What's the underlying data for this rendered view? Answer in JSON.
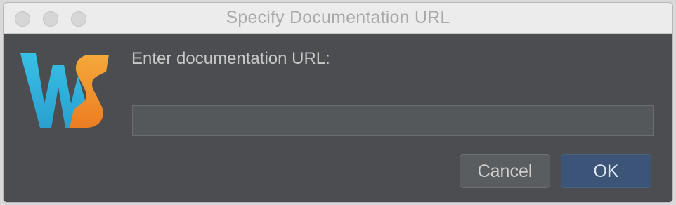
{
  "window": {
    "title": "Specify Documentation URL"
  },
  "titlebar": {
    "buttons": [
      "close-button",
      "minimize-button",
      "zoom-button"
    ]
  },
  "logo": {
    "icon": "webstorm-logo-icon",
    "colors": {
      "cyan": "#2fb4d9",
      "orange": "#f0922b"
    }
  },
  "form": {
    "prompt": "Enter documentation URL:",
    "url_value": "",
    "url_placeholder": ""
  },
  "buttons": {
    "cancel_label": "Cancel",
    "ok_label": "OK"
  },
  "colors": {
    "background": "#4b4d50",
    "primary_button": "#3b5478",
    "titlebar": "#ececec"
  }
}
